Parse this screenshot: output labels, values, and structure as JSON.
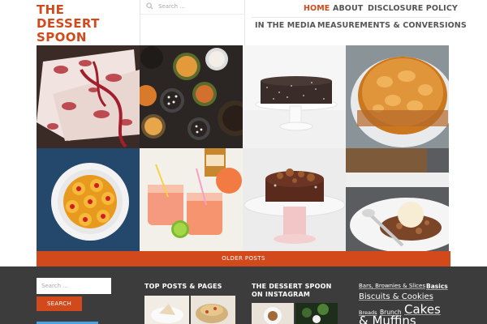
{
  "site": {
    "title_line1": "THE",
    "title_line2": "DESSERT",
    "title_line3": "SPOON",
    "brand_color": "#d24a1b"
  },
  "search": {
    "placeholder": "Search ..."
  },
  "nav": {
    "row1": [
      {
        "label": "HOME",
        "active": true
      },
      {
        "label": "ABOUT",
        "active": false
      },
      {
        "label": "DISCLOSURE POLICY",
        "active": false
      }
    ],
    "row2": [
      {
        "label": "IN THE MEDIA"
      },
      {
        "label": "MEASUREMENTS & CONVERSIONS"
      }
    ]
  },
  "grid": {
    "tiles": [
      "red-floral-napkin",
      "cupcakes-top-view",
      "chocolate-coconut-cake",
      "apricot-tart",
      "pineapple-upside-down-cake",
      "grapefruit-drinks",
      "walnut-bundt-cake",
      "ice-cream-crumble"
    ]
  },
  "pagination": {
    "older_label": "OLDER POSTS"
  },
  "footer": {
    "search_placeholder": "Search ...",
    "search_button": "SEARCH",
    "top_posts_heading": "TOP POSTS & PAGES",
    "instagram_heading_line1": "THE DESSERT SPOON",
    "instagram_heading_line2": "ON INSTAGRAM",
    "tags": {
      "t1": "Bars, Brownies & Slices",
      "t2": "Basics",
      "t3": "Biscuits & Cookies",
      "t4": "Breads",
      "t5": "Brunch",
      "t6": "Cakes",
      "t7": "& Muffins"
    }
  }
}
